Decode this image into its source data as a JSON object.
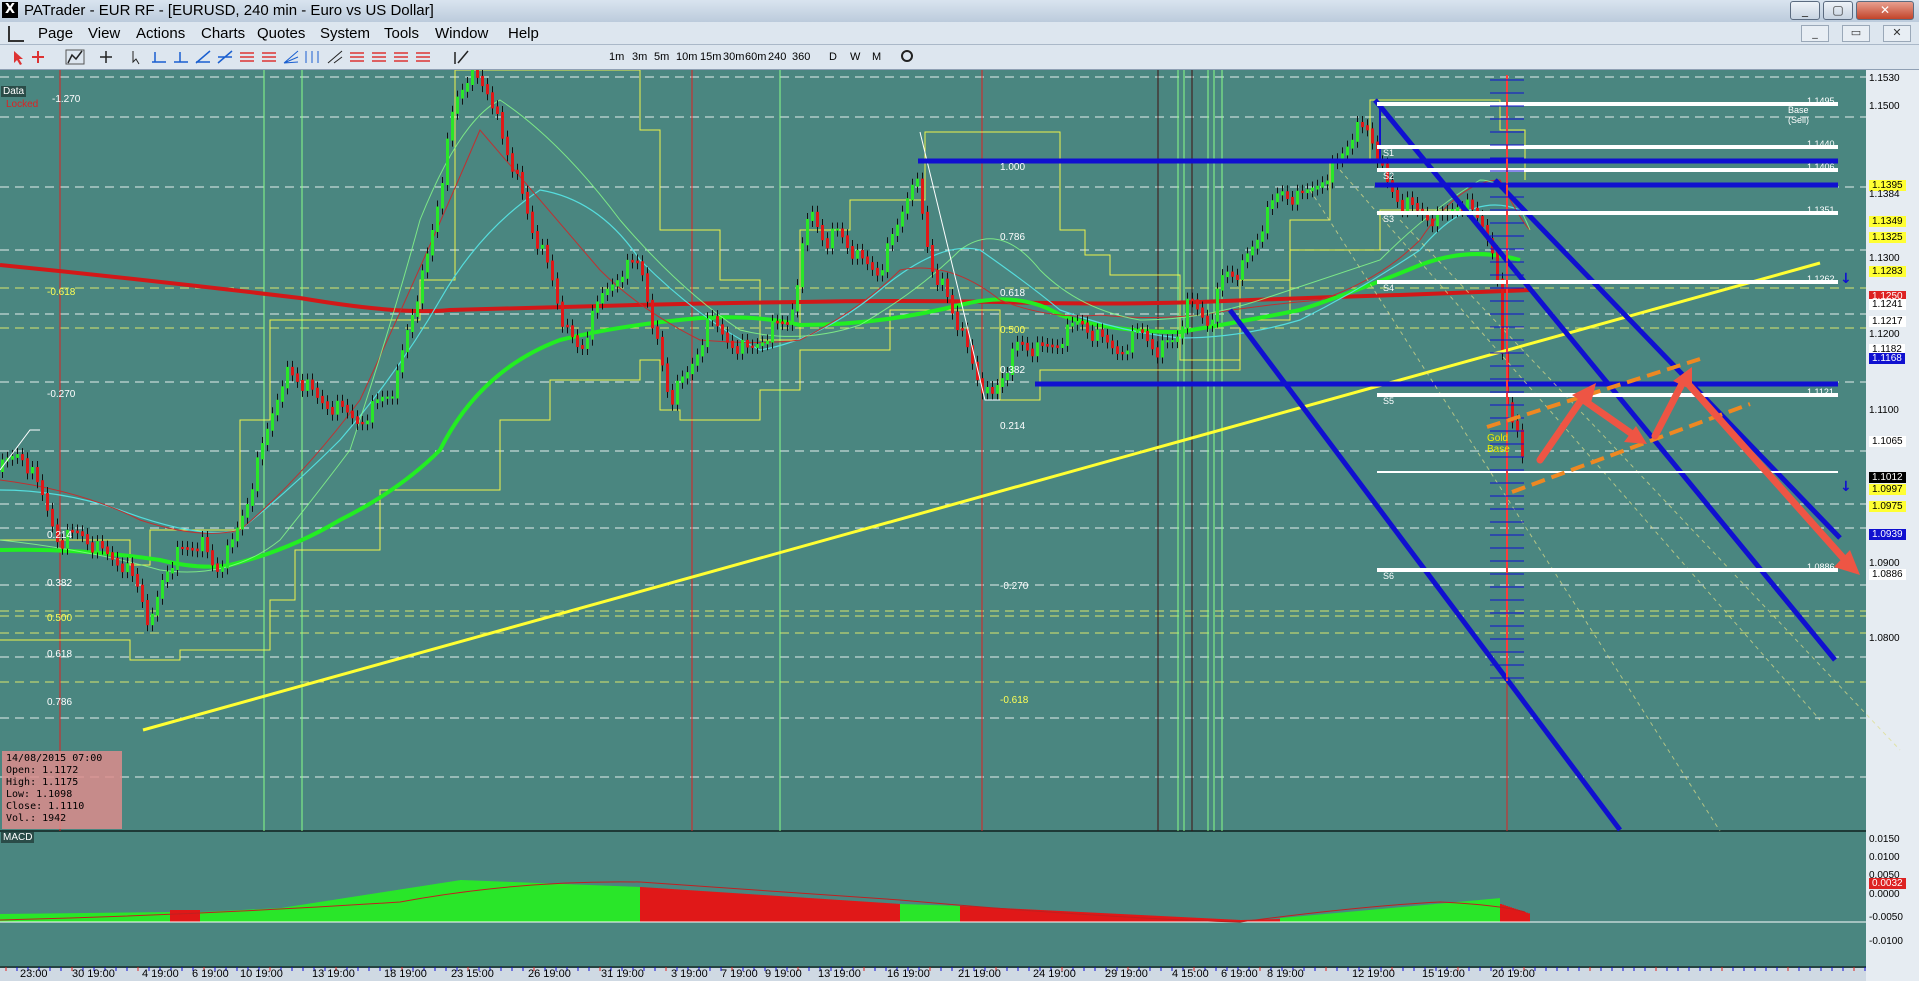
{
  "window": {
    "title": "PATrader - EUR RF - [EURUSD, 240 min - Euro vs US Dollar]",
    "app_icon": "X"
  },
  "menu": [
    "Page",
    "View",
    "Actions",
    "Charts",
    "Quotes",
    "System",
    "Tools",
    "Window",
    "Help"
  ],
  "timeframes": [
    "1m",
    "3m",
    "5m",
    "10m",
    "15m",
    "30m",
    "60m",
    "240",
    "360",
    "D",
    "W",
    "M"
  ],
  "chart": {
    "data_tag": "Data",
    "locked_tag": "Locked",
    "fib_left": [
      "-1.270",
      "-0.618",
      "-0.270",
      "0.214",
      "0.382",
      "0.500",
      "0.618",
      "0.786"
    ],
    "fib_mid": [
      "1.000",
      "0.786",
      "0.618",
      "0.500",
      "0.382",
      "0.214",
      "-0.270",
      "-0.618"
    ],
    "levels_right": [
      {
        "price": "1.1495",
        "label": "Base (Sell)"
      },
      {
        "price": "1.1440",
        "label": "S1"
      },
      {
        "price": "1.1406",
        "label": "S2"
      },
      {
        "price": "1.1351",
        "label": "S3"
      },
      {
        "price": "1.1262",
        "label": "S4"
      },
      {
        "price": "1.1121",
        "label": "S5"
      },
      {
        "price": "1.0886",
        "label": "S6"
      }
    ],
    "gold_base_label": "Gold Base",
    "price_axis": [
      "1.1530",
      "1.1500",
      "1.1395",
      "1.1384",
      "1.1349",
      "1.1325",
      "1.1300",
      "1.1283",
      "1.1250",
      "1.1241",
      "1.1217",
      "1.1200",
      "1.1182",
      "1.1168",
      "1.1100",
      "1.1065",
      "1.1012",
      "1.0997",
      "1.0975",
      "1.0939",
      "1.0900",
      "1.0886",
      "1.0800"
    ],
    "info": {
      "datetime": "14/08/2015 07:00",
      "open": "Open: 1.1172",
      "high": "High: 1.1175",
      "low": "Low: 1.1098",
      "close": "Close: 1.1110",
      "vol": "Vol.: 1942"
    },
    "macd_label": "MACD",
    "macd_axis": [
      "0.0150",
      "0.0100",
      "0.0050",
      "0.0032",
      "0.0000",
      "-0.0050",
      "-0.0100"
    ],
    "date_axis": [
      "23:00",
      "30 19:00",
      "4 19:00",
      "6 19:00",
      "10 19:00",
      "13 19:00",
      "18 19:00",
      "23 15:00",
      "26 19:00",
      "31 19:00",
      "3 19:00",
      "7 19:00",
      "9 19:00",
      "13 19:00",
      "16 19:00",
      "21 19:00",
      "24 19:00",
      "29 19:00",
      "4 15:00",
      "6 19:00",
      "8 19:00",
      "12 19:00",
      "15 19:00",
      "20 19:00"
    ]
  },
  "colors": {
    "chart_bg": "#4a8680",
    "panel_bg": "#2e5f5a",
    "bull": "#29e629",
    "bear": "#e01818",
    "channel": "#1010d0",
    "trendline": "#ffff33",
    "arrow": "#ee5544"
  }
}
